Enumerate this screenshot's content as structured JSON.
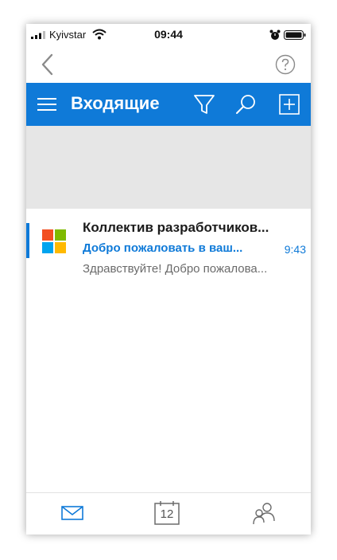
{
  "status_bar": {
    "carrier": "Kyivstar",
    "time": "09:44"
  },
  "header": {
    "title": "Входящие"
  },
  "messages": [
    {
      "sender": "Коллектив разработчиков...",
      "subject": "Добро пожаловать в ваш...",
      "time": "9:43",
      "preview": "Здравствуйте! Добро пожалова..."
    }
  ],
  "tab_bar": {
    "calendar_day": "12"
  },
  "colors": {
    "accent": "#0f7ad8",
    "banner": "#e6e6e6"
  },
  "icons": [
    "signal-icon",
    "wifi-icon",
    "alarm-icon",
    "battery-icon",
    "back-icon",
    "help-icon",
    "menu-icon",
    "filter-icon",
    "search-icon",
    "compose-icon",
    "microsoft-logo",
    "mail-icon",
    "calendar-icon",
    "people-icon"
  ]
}
